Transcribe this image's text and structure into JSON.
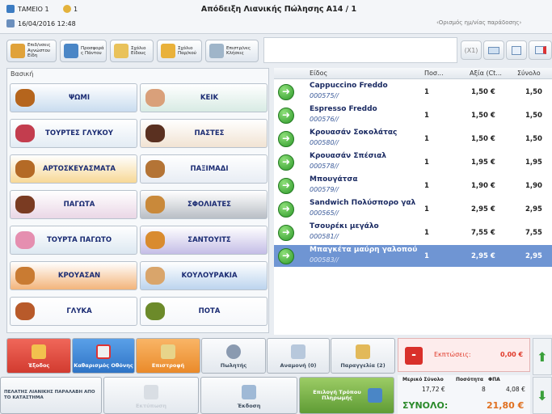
{
  "header": {
    "register": "ΤΑΜΕΙΟ 1",
    "datetime": "16/04/2016 12:48",
    "user": "1",
    "title": "Απόδειξη Λιανικής Πώλησης Α14 / 1",
    "define_placeholder": "‹Ορισμός ημ/νίας παράδοσης›"
  },
  "toolbar": {
    "btn1": "Επιδ/νσεις Αγνώστου Είδη",
    "btn2": "Προσφορά ς Πάντου",
    "btn3": "Σχόλιο Είδους",
    "btn4": "Σχόλιο Παρ/κού",
    "btn5": "Επιστρ/νες Κλήσεις",
    "qty": "(X1)"
  },
  "categories": {
    "header": "Βασική",
    "items": [
      {
        "label": "ΨΩΜΙ",
        "color": "#c9dcef",
        "icon": "#b5651d"
      },
      {
        "label": "ΚΕΙΚ",
        "color": "#d8ebe4",
        "icon": "#d9a07a"
      },
      {
        "label": "ΤΟΥΡΤΕΣ ΓΛΥΚΟΥ",
        "color": "#e3ecf4",
        "icon": "#c33d4e"
      },
      {
        "label": "ΠΑΣΤΕΣ",
        "color": "#f1e3d3",
        "icon": "#5a3020"
      },
      {
        "label": "ΑΡΤΟΣΚΕΥΑΣΜΑΤΑ",
        "color": "#f7d896",
        "icon": "#b46a26"
      },
      {
        "label": "ΠΑΞΙΜΑΔΙ",
        "color": "#e8edf4",
        "icon": "#b47436"
      },
      {
        "label": "ΠΑΓΩΤΑ",
        "color": "#ead7e6",
        "icon": "#7a3b22"
      },
      {
        "label": "ΣΦΟΛΙΑΤΕΣ",
        "color": "#b9bec5",
        "icon": "#c9893a"
      },
      {
        "label": "ΤΟΥΡΤΑ ΠΑΓΩΤΟ",
        "color": "#dde8f1",
        "icon": "#e58fb0"
      },
      {
        "label": "ΣΑΝΤΟΥΙΤΣ",
        "color": "#c4bde6",
        "icon": "#d98b2f"
      },
      {
        "label": "ΚΡΟΥΑΣΑΝ",
        "color": "#f3b47a",
        "icon": "#c97b32"
      },
      {
        "label": "ΚΟΥΛΟΥΡΑΚΙΑ",
        "color": "#bcd4ee",
        "icon": "#d9a56b"
      },
      {
        "label": "ΓΛΥΚΑ",
        "color": "#f5f7fa",
        "icon": "#b85a2a"
      },
      {
        "label": "ΠΟΤΑ",
        "color": "#f5f7fa",
        "icon": "#6c8a2a"
      }
    ]
  },
  "list": {
    "columns": [
      "Είδος",
      "Ποσ...",
      "Αξία (Ct...",
      "Σύνολο"
    ],
    "rows": [
      {
        "name": "Cappuccino Freddo",
        "code": "000575//",
        "qty": "1",
        "price": "1,50 €",
        "total": "1,50"
      },
      {
        "name": "Espresso Freddo",
        "code": "000576//",
        "qty": "1",
        "price": "1,50 €",
        "total": "1,50"
      },
      {
        "name": "Κρουασάν Σοκολάτας",
        "code": "000580//",
        "qty": "1",
        "price": "1,50 €",
        "total": "1,50"
      },
      {
        "name": "Κρουασάν Σπέσιαλ",
        "code": "000578//",
        "qty": "1",
        "price": "1,95 €",
        "total": "1,95"
      },
      {
        "name": "Μπουγάτσα",
        "code": "000579//",
        "qty": "1",
        "price": "1,90 €",
        "total": "1,90"
      },
      {
        "name": "Sandwich Πολύσπορο γαλ",
        "code": "000565//",
        "qty": "1",
        "price": "2,95 €",
        "total": "2,95"
      },
      {
        "name": "Τσουρέκι μεγάλο",
        "code": "000581//",
        "qty": "1",
        "price": "7,55 €",
        "total": "7,55"
      },
      {
        "name": "Μπαγκέτα μαύρη γαλοπού",
        "code": "000583//",
        "qty": "1",
        "price": "2,95 €",
        "total": "2,95"
      }
    ]
  },
  "bottom": {
    "exit": "Έξοδος",
    "clear": "Καθαρισμός Οθόνης",
    "return": "Επιστροφή",
    "seller": "Πωλητής",
    "hold": "Αναμονή (0)",
    "order": "Παραγγελία (2)",
    "customer": "ΠΕΛΑΤΗΣ ΛΙΑΝΙΚΗΣ ΠΑΡΑΛΑΒΗ ΑΠΟ ΤΟ ΚΑΤΑΣΤΗΜΑ",
    "print": "Εκτύπωση",
    "receipt": "Έκδοση",
    "payment": "Επιλογή Τρόπου Πληρωμής"
  },
  "totals": {
    "discount_label": "Εκπτώσεις:",
    "discount_value": "0,00 €",
    "partial_label": "Μερικό Σύνολο",
    "qty_label": "Ποσότητα",
    "vat_label": "ΦΠΑ",
    "partial_value": "17,72 €",
    "qty_value": "8",
    "vat_value": "4,08 €",
    "total_label": "ΣΥΝΟΛΟ:",
    "total_value": "21,80 €"
  }
}
